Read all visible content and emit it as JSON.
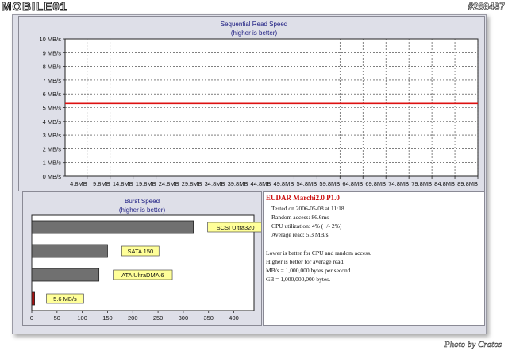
{
  "watermark": {
    "logo": "MOBILE01",
    "id_tag": "#268487"
  },
  "credit": "Photo by Cratos",
  "colors": {
    "background": "#dedfe8",
    "seq_line": "#dd1111",
    "bar_fill": "#707070",
    "label_fill": "#ffff99",
    "info_title": "#cc1111"
  },
  "chart_data": [
    {
      "type": "line",
      "title": "Sequential Read Speed",
      "subtitle": "(higher is better)",
      "y_ticks": [
        "0 MB/s",
        "1 MB/s",
        "2 MB/s",
        "3 MB/s",
        "4 MB/s",
        "5 MB/s",
        "6 MB/s",
        "7 MB/s",
        "8 MB/s",
        "9 MB/s",
        "10 MB/s"
      ],
      "x_ticks": [
        "4.8MB",
        "9.8MB",
        "14.8MB",
        "19.8MB",
        "24.8MB",
        "29.8MB",
        "34.8MB",
        "39.8MB",
        "44.8MB",
        "49.8MB",
        "54.8MB",
        "59.8MB",
        "64.8MB",
        "69.8MB",
        "74.8MB",
        "79.8MB",
        "84.8MB",
        "89.8MB"
      ],
      "ylim": [
        0,
        10
      ],
      "xlim": [
        0,
        89.8
      ],
      "grid": true,
      "series": [
        {
          "x": [
            0,
            89.8
          ],
          "y": [
            5.3,
            5.3
          ]
        }
      ]
    },
    {
      "type": "bar",
      "orientation": "horizontal",
      "title": "Burst Speed",
      "subtitle": "(higher is better)",
      "categories": [
        "SCSI Ultra320",
        "SATA 150",
        "ATA UltraDMA 6",
        "5.6 MB/s"
      ],
      "values": [
        320,
        150,
        133,
        5.6
      ],
      "x_ticks": [
        "0",
        "50",
        "100",
        "150",
        "200",
        "250",
        "300",
        "350",
        "400"
      ],
      "xlim": [
        0,
        440
      ],
      "grid": false
    }
  ],
  "info": {
    "title": "EUDAR Marchi2.0 P1.0",
    "lines": [
      "Tested on 2006-05-08 at 11:18",
      "Random access: 86.6ms",
      "CPU utilization: 4% (+/- 2%)",
      "Average read: 5.3 MB/s"
    ],
    "notes": [
      "Lower is better for CPU and random access.",
      "Higher is better for average read.",
      "MB/s = 1,000,000 bytes per second.",
      "GB = 1,000,000,000 bytes."
    ]
  }
}
